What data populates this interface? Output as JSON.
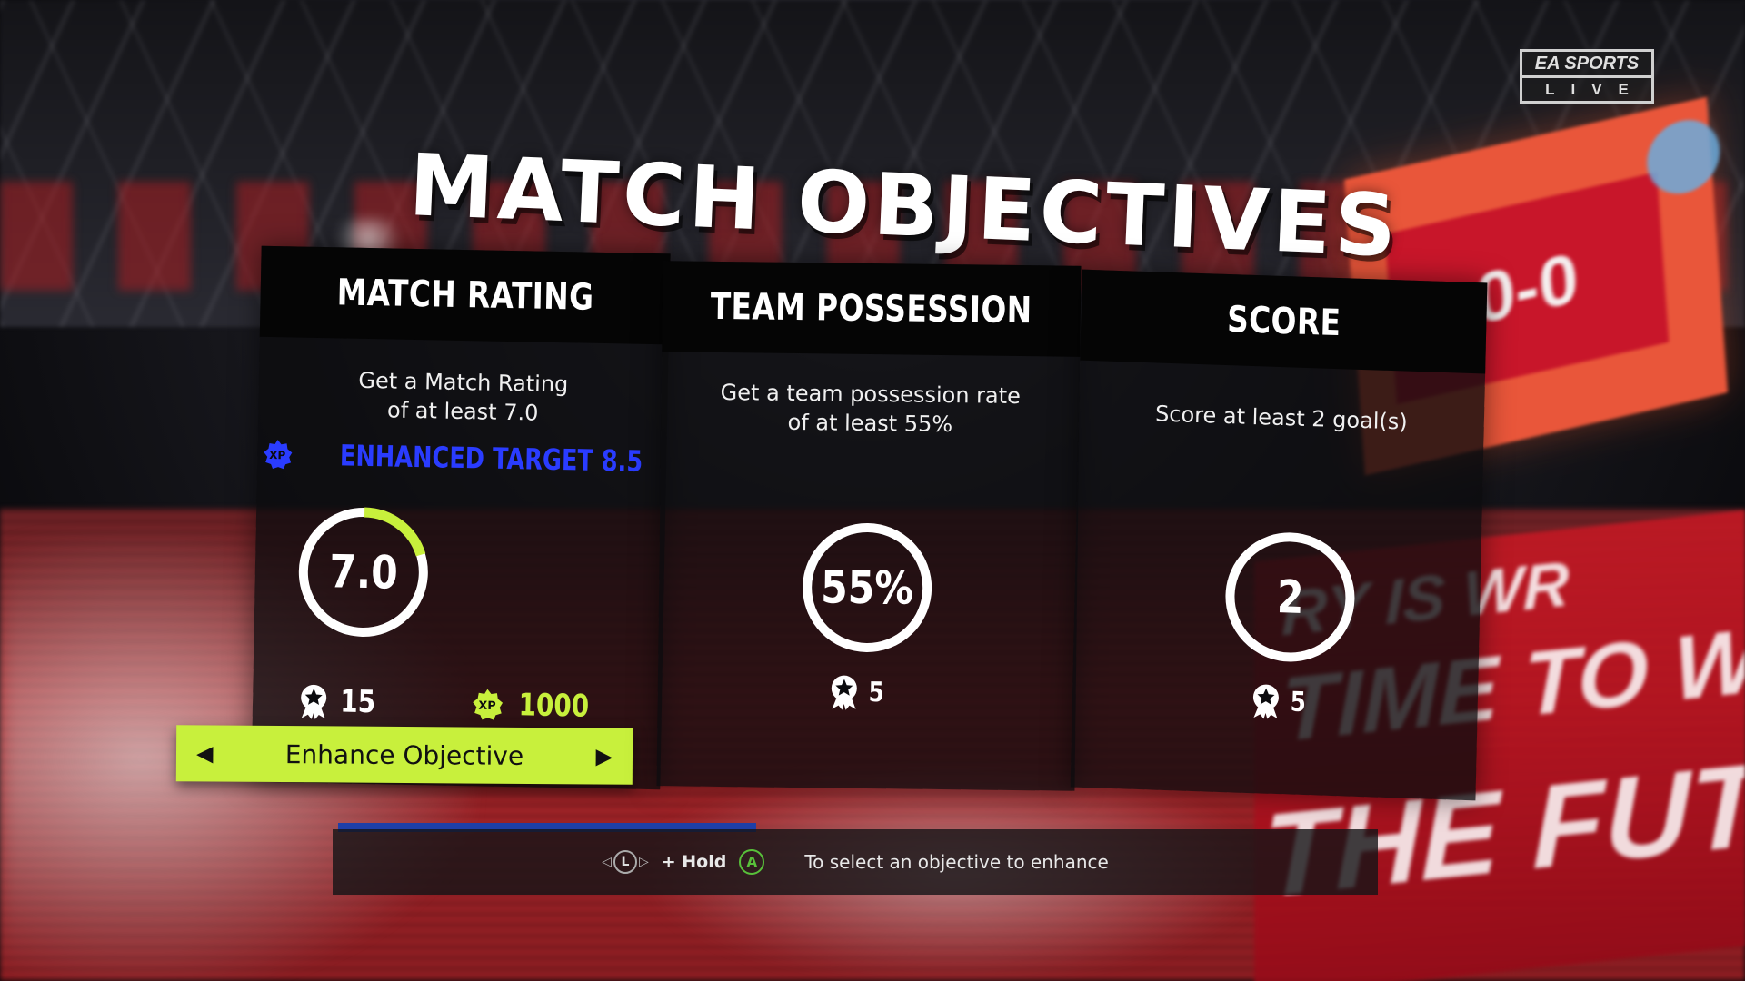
{
  "logo": {
    "top": "EA SPORTS",
    "bottom": "LIVE"
  },
  "title": "MATCH OBJECTIVES",
  "scoreboard": {
    "score": "0-0"
  },
  "background_banner": {
    "line1": "RY IS WR",
    "line2": "TIME TO W",
    "line3": "THE FUTU"
  },
  "objectives": [
    {
      "name": "MATCH RATING",
      "description_line1": "Get a Match Rating",
      "description_line2": "of at least 7.0",
      "enhanced_target": "ENHANCED TARGET 8.5",
      "value": "7.0",
      "progress_fraction": 0.2,
      "ring_color": "#c8f03c",
      "reward_points": "15",
      "reward_xp": "1000"
    },
    {
      "name": "TEAM POSSESSION",
      "description_line1": "Get a team possession rate",
      "description_line2": "of at least 55%",
      "value": "55%",
      "progress_fraction": 0,
      "reward_points": "5"
    },
    {
      "name": "SCORE",
      "description_line1": "Score at least 2 goal(s)",
      "value": "2",
      "progress_fraction": 0,
      "reward_points": "5"
    }
  ],
  "enhance_button": {
    "label": "Enhance Objective"
  },
  "selection_progress": 0.4,
  "hint": {
    "stick_icon": "left-stick-icon",
    "stick_label": "L",
    "hold_label": "+ Hold",
    "button_icon": "a-button-icon",
    "button_label": "A",
    "text": "To select an objective to enhance"
  },
  "colors": {
    "accent_green": "#c8f03c",
    "enhanced_blue": "#2a3cff",
    "progress_blue": "#1e3fa8",
    "a_button_green": "#58c03a"
  }
}
